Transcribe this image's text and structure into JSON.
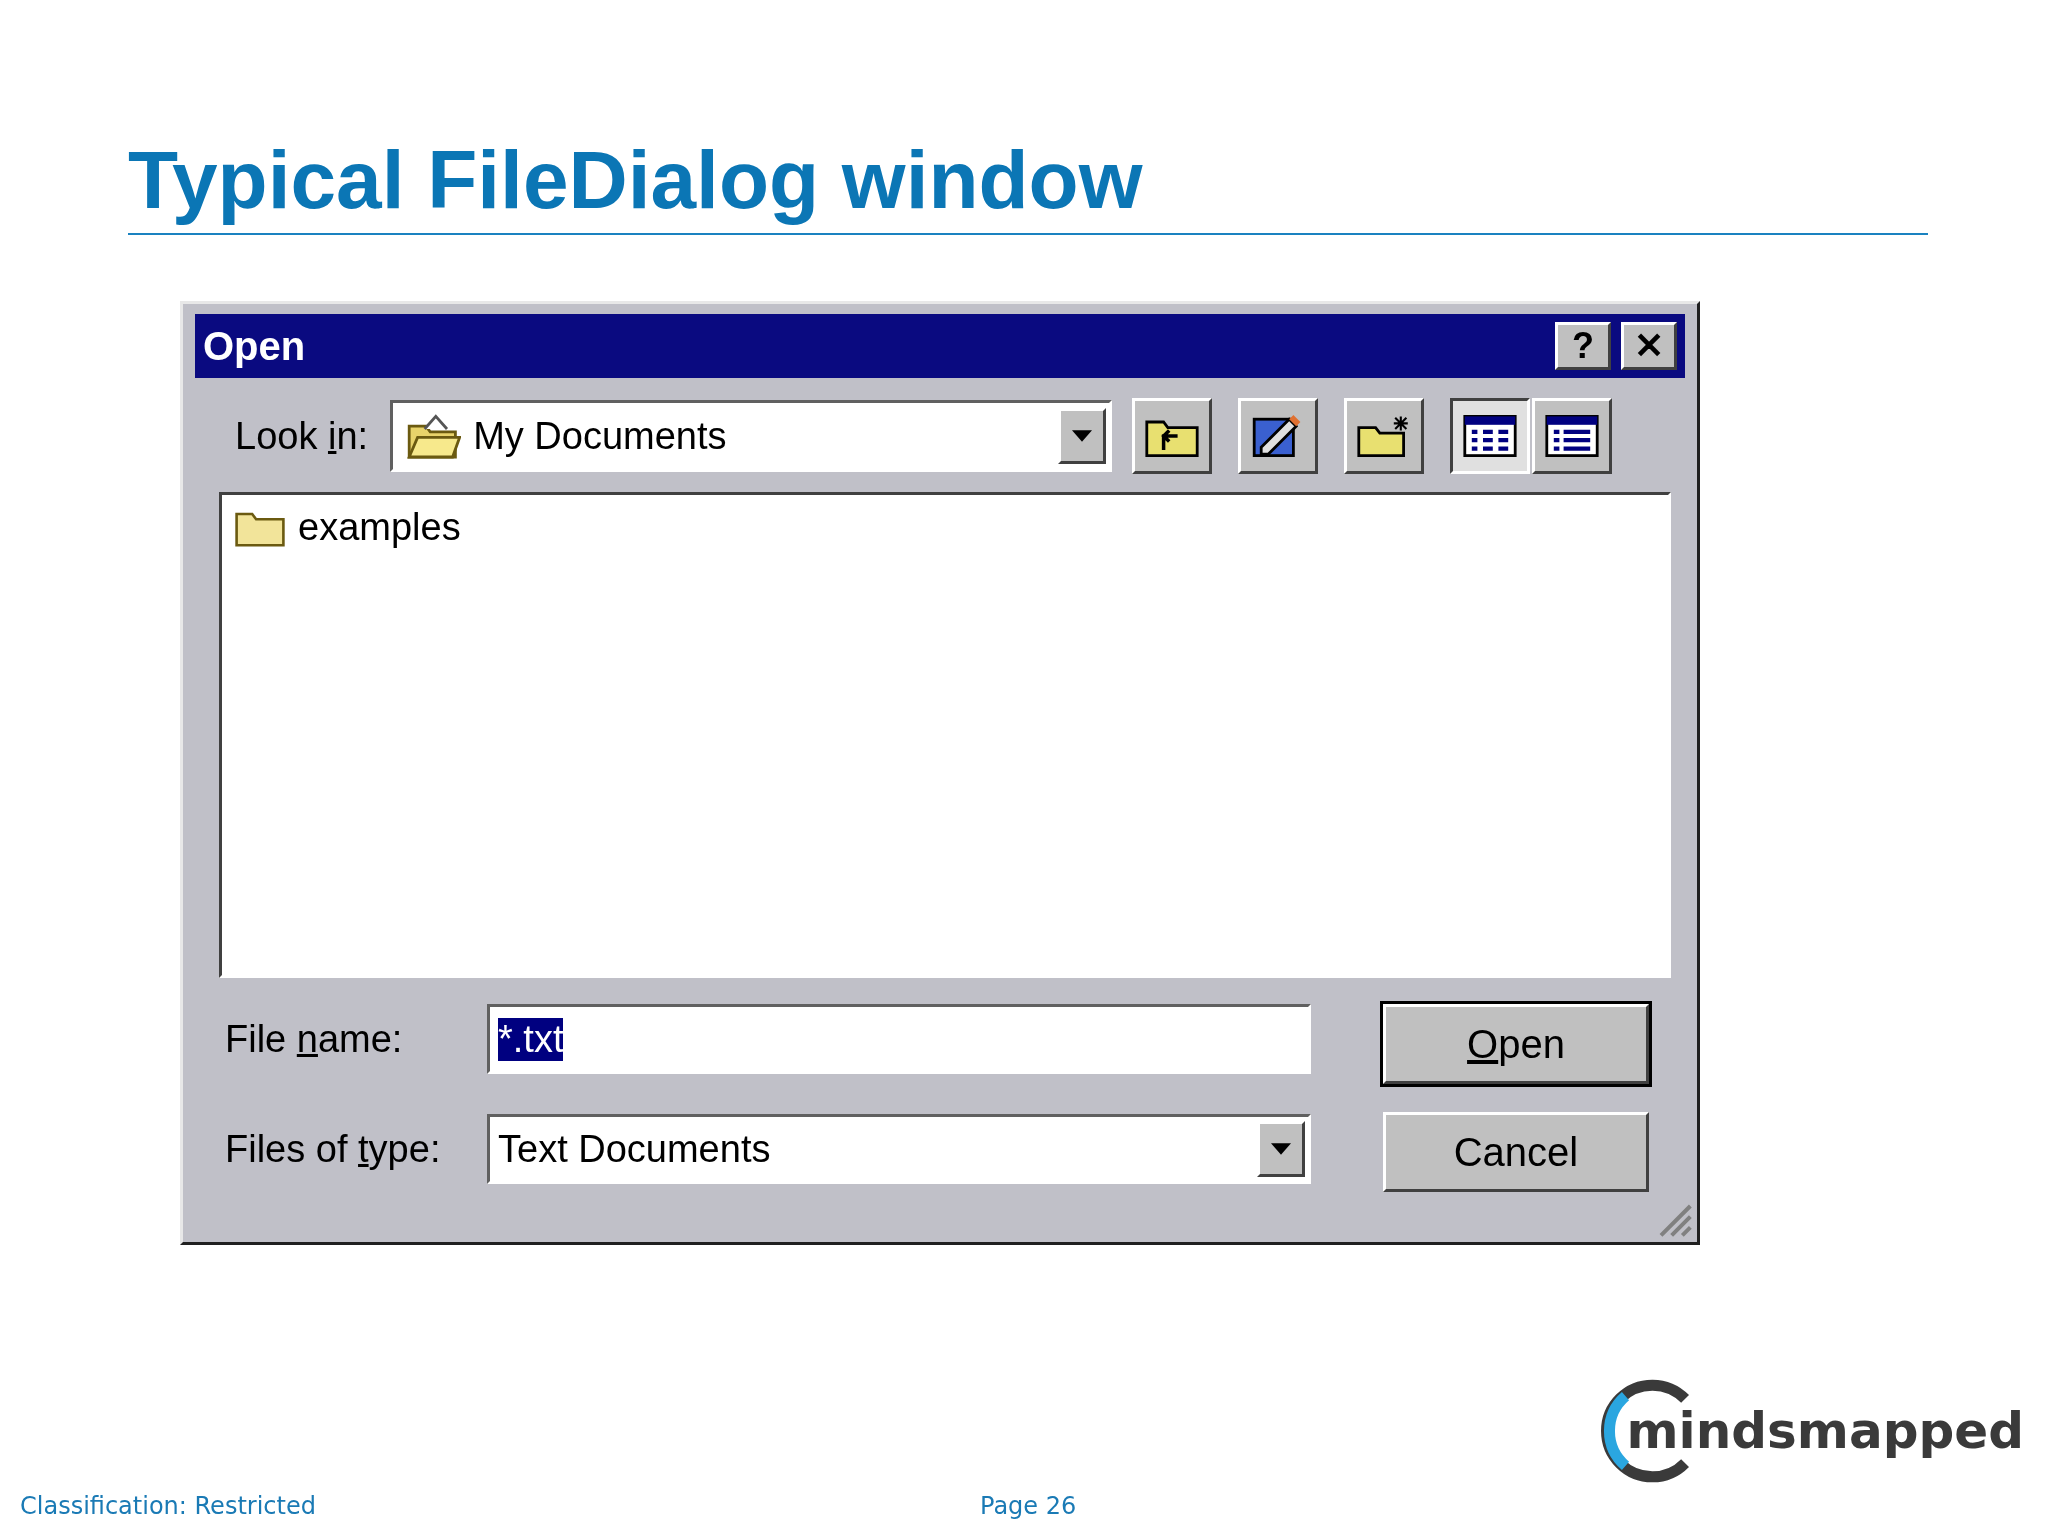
{
  "slide_title": "Typical FileDialog window",
  "dialog": {
    "title": "Open",
    "title_buttons": [
      {
        "label": "?"
      },
      {
        "label": "✕"
      }
    ],
    "look_in": {
      "label": {
        "before": "Look ",
        "key": "i",
        "after": "n:"
      },
      "value": "My Documents"
    },
    "toolbar": [
      {
        "kind": "up"
      },
      {
        "kind": "desktop"
      },
      {
        "kind": "new_folder"
      },
      {
        "kind": "list",
        "selected": true
      },
      {
        "kind": "details",
        "selected": false
      }
    ],
    "files": [
      {
        "name": "examples",
        "selected": false
      }
    ],
    "file_name": {
      "label": {
        "before": "File ",
        "key": "n",
        "after": "ame:"
      },
      "value": "*.txt",
      "value_selected": true
    },
    "file_type": {
      "label": {
        "before": "Files of ",
        "key": "t",
        "after": "ype:"
      },
      "value": "Text Documents"
    },
    "buttons": [
      {
        "kind": "default",
        "label": {
          "key": "O",
          "after": "pen"
        }
      },
      {
        "kind": "normal",
        "label": {
          "before": "Cancel"
        }
      }
    ]
  },
  "logo": {
    "text": "mindsmapped"
  },
  "footer": {
    "classification": "Classification: Restricted",
    "page": "Page 26"
  }
}
